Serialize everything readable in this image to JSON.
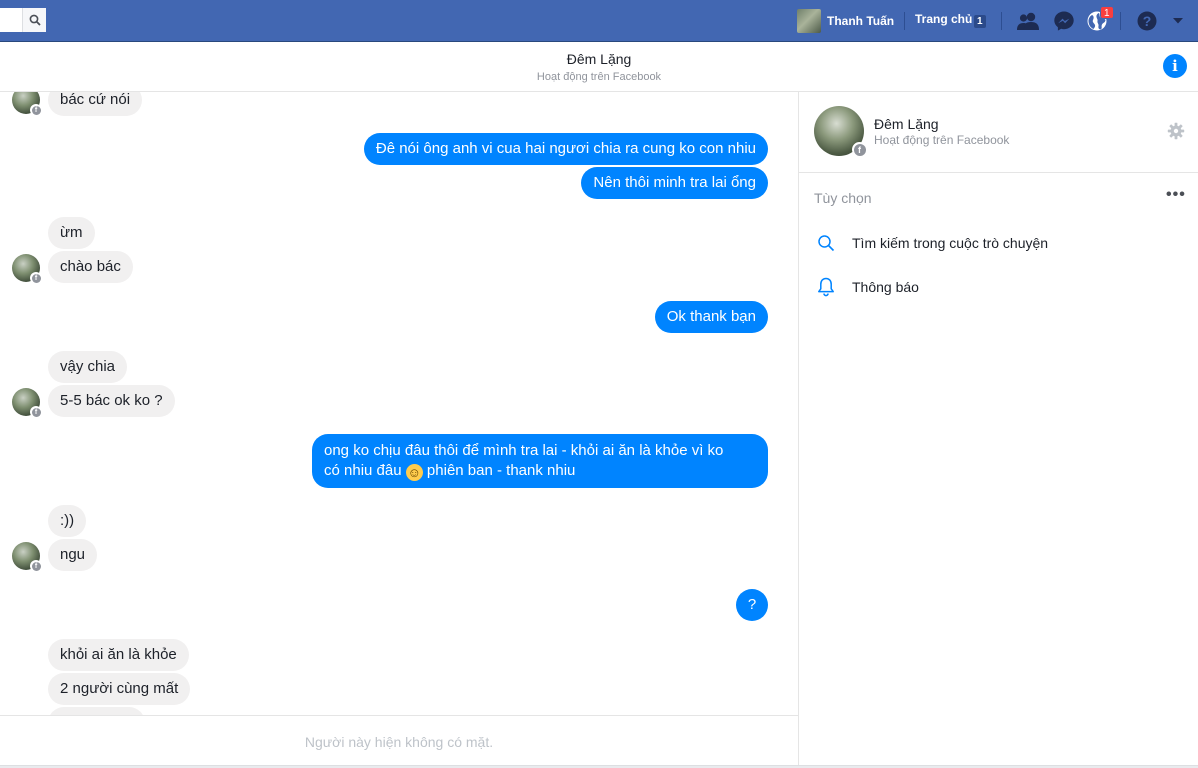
{
  "topbar": {
    "user_name": "Thanh Tuấn",
    "home_label": "Trang chủ",
    "home_count": "1",
    "notification_count": "1",
    "colors": {
      "bar": "#4267b2",
      "badge": "#fa3e3e"
    }
  },
  "conversation": {
    "title": "Đêm Lặng",
    "status": "Hoạt động trên Facebook"
  },
  "messages": {
    "m1": "bác cứ nói",
    "m2": "Đê nói ông anh vi cua hai ngươi chia ra cung ko con nhiu",
    "m3": "Nên thôi minh tra lai ổng",
    "m4": "ừm",
    "m5": "chào bác",
    "m6": "Ok thank bạn",
    "m7": "vậy chia",
    "m8": "5-5 bác ok ko ?",
    "m9_line1": "ong ko chịu đâu thôi để mình tra lai - khỏi ai ăn là khỏe vì ko",
    "m9_line2_a": "có nhiu đâu",
    "m9_emoji": "☺",
    "m9_line2_b": "phiên ban - thank nhiu",
    "m10": ":))",
    "m11": "ngu",
    "m12": "?",
    "m13": "khỏi ai ăn là khỏe",
    "m14": "2 người cùng mất"
  },
  "composer": {
    "unavailable_text": "Người này hiện không có mặt."
  },
  "right_panel": {
    "name": "Đêm Lặng",
    "status": "Hoạt động trên Facebook",
    "options_label": "Tùy chọn",
    "more_label": "•••",
    "items": [
      {
        "label": "Tìm kiếm trong cuộc trò chuyện",
        "icon": "search-icon"
      },
      {
        "label": "Thông báo",
        "icon": "bell-icon"
      }
    ]
  },
  "colors": {
    "outgoing_bubble": "#0084ff",
    "incoming_bubble": "#f1f0f0",
    "accent": "#0084ff"
  }
}
